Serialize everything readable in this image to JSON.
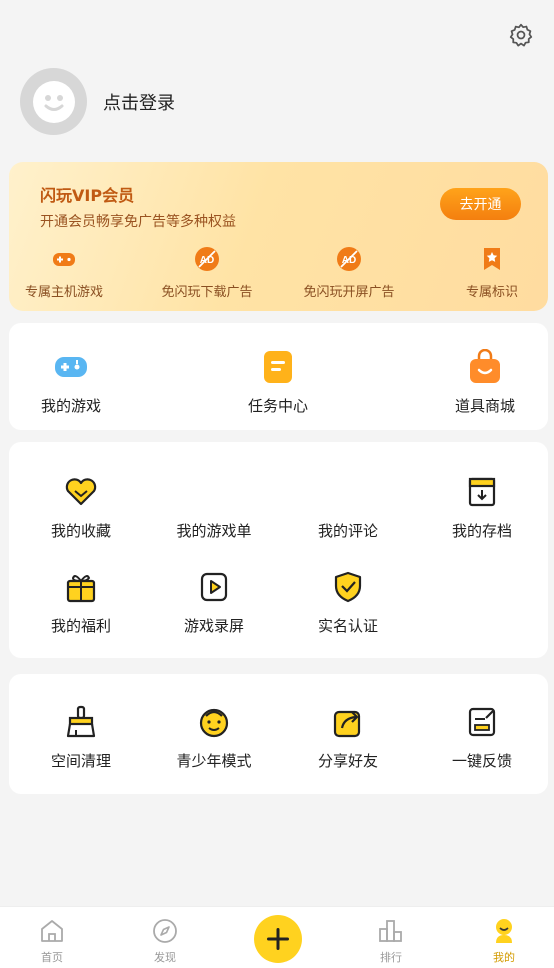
{
  "profile": {
    "login_text": "点击登录"
  },
  "vip": {
    "title": "闪玩VIP会员",
    "subtitle": "开通会员畅享免广告等多种权益",
    "button": "去开通",
    "features": [
      "专属主机游戏",
      "免闪玩下载广告",
      "免闪玩开屏广告",
      "专属标识"
    ]
  },
  "main_actions": [
    "我的游戏",
    "任务中心",
    "道具商城"
  ],
  "my_items": [
    "我的收藏",
    "我的游戏单",
    "我的评论",
    "我的存档",
    "我的福利",
    "游戏录屏",
    "实名认证"
  ],
  "tools": [
    "空间清理",
    "青少年模式",
    "分享好友",
    "一键反馈"
  ],
  "nav": {
    "home": "首页",
    "discover": "发现",
    "rank": "排行",
    "mine": "我的"
  },
  "colors": {
    "accent": "#ffd21f",
    "vip_button": "#f47f0f"
  }
}
